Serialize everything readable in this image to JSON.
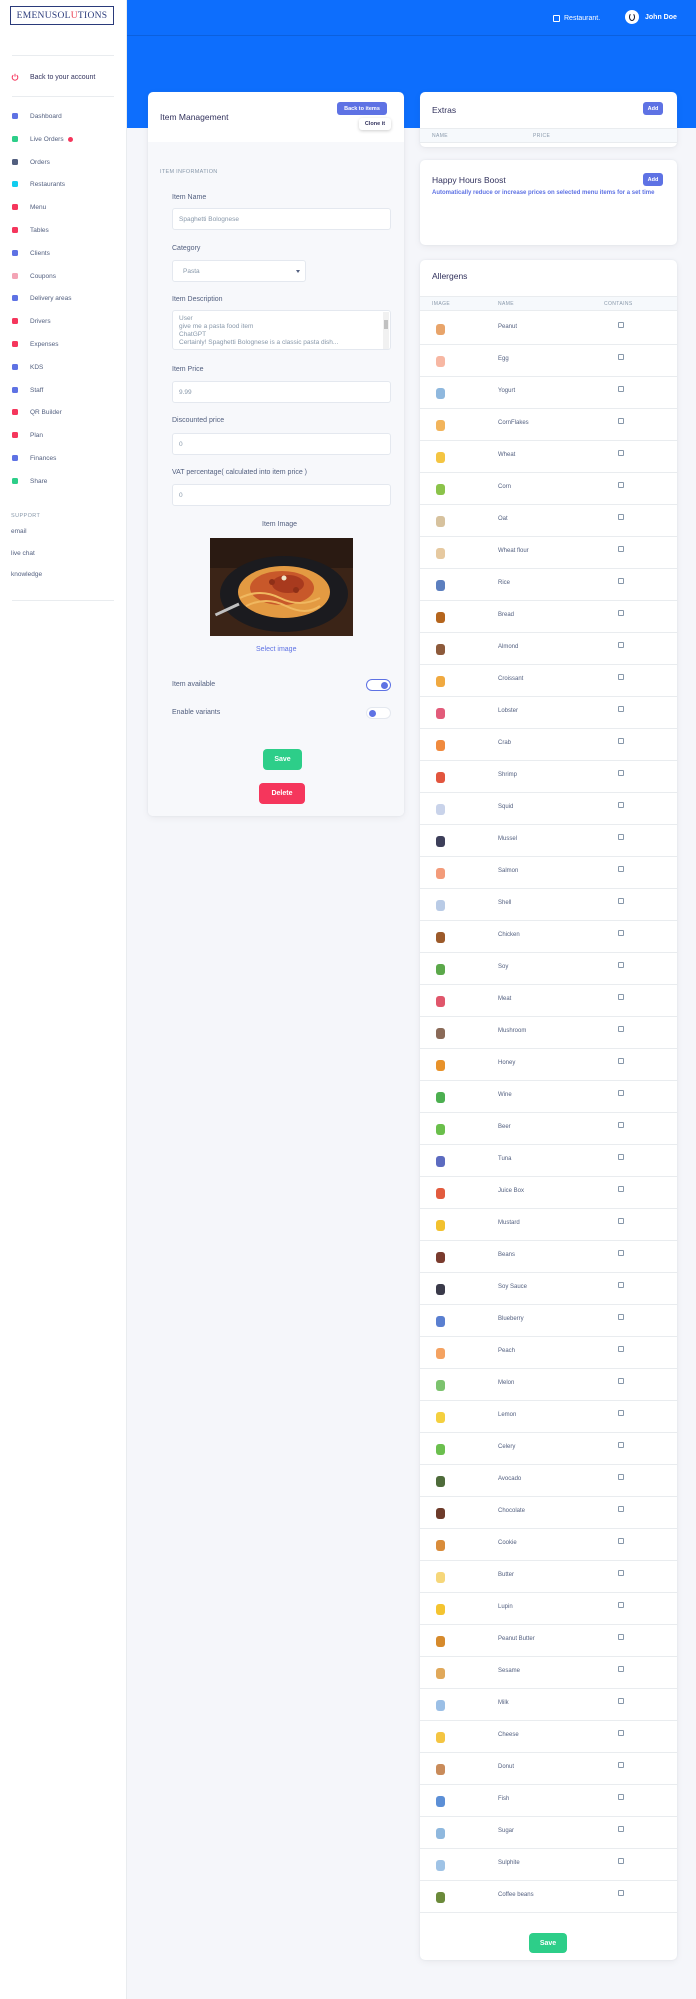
{
  "brand": {
    "logo_prefix": "EMENUSOL",
    "logo_highlight": "U",
    "logo_suffix": "TIONS"
  },
  "sidebar": {
    "back": "Back to your account",
    "items": [
      {
        "label": "Dashboard",
        "icon": "monitor-icon",
        "color": "#5e72e4"
      },
      {
        "label": "Live Orders",
        "icon": "grid-icon",
        "color": "#2dce89"
      },
      {
        "label": "Orders",
        "icon": "basket-icon",
        "color": "#525f7f"
      },
      {
        "label": "Restaurants",
        "icon": "shop-icon",
        "color": "#11cdef"
      },
      {
        "label": "Menu",
        "icon": "book-icon",
        "color": "#f5365c"
      },
      {
        "label": "Tables",
        "icon": "table-icon",
        "color": "#f5365c"
      },
      {
        "label": "Clients",
        "icon": "user-icon",
        "color": "#5e72e4"
      },
      {
        "label": "Coupons",
        "icon": "tag-icon",
        "color": "#f3a4b5"
      },
      {
        "label": "Delivery areas",
        "icon": "pin-icon",
        "color": "#5e72e4"
      },
      {
        "label": "Drivers",
        "icon": "driver-icon",
        "color": "#f5365c"
      },
      {
        "label": "Expenses",
        "icon": "bill-icon",
        "color": "#f5365c"
      },
      {
        "label": "KDS",
        "icon": "screen-icon",
        "color": "#5e72e4"
      },
      {
        "label": "Staff",
        "icon": "staff-icon",
        "color": "#5e72e4"
      },
      {
        "label": "QR Builder",
        "icon": "qr-icon",
        "color": "#f5365c"
      },
      {
        "label": "Plan",
        "icon": "card-icon",
        "color": "#f5365c"
      },
      {
        "label": "Finances",
        "icon": "finance-icon",
        "color": "#5e72e4"
      },
      {
        "label": "Share",
        "icon": "share-icon",
        "color": "#2dce89"
      }
    ],
    "support_heading": "SUPPORT",
    "support_links": [
      "email",
      "live chat",
      "knowledge"
    ]
  },
  "header": {
    "restaurant": "Restaurant.",
    "user": "John Doe"
  },
  "item_management": {
    "title": "Item Management",
    "back_button": "Back to items",
    "clone_button": "Clone it",
    "section": "ITEM INFORMATION",
    "name_label": "Item Name",
    "name_value": "Spaghetti Bolognese",
    "category_label": "Category",
    "category_value": "Pasta",
    "description_label": "Item Description",
    "description_lines": [
      "User",
      "give me a pasta food item",
      "ChatGPT",
      "Certainly! Spaghetti Bolognese is a classic pasta dish..."
    ],
    "price_label": "Item Price",
    "price_value": "9.99",
    "discount_label": "Discounted price",
    "discount_value": "0",
    "vat_label": "VAT percentage( calculated into item price )",
    "vat_value": "0",
    "image_label": "Item Image",
    "select_image": "Select image",
    "available_label": "Item available",
    "available_on": true,
    "variants_label": "Enable variants",
    "variants_on": false,
    "save": "Save",
    "delete": "Delete"
  },
  "extras": {
    "title": "Extras",
    "add": "Add",
    "col_name": "NAME",
    "col_price": "PRICE"
  },
  "happy_hours": {
    "title": "Happy Hours Boost",
    "add": "Add",
    "description": "Automatically reduce or increase prices on selected menu items for a set time"
  },
  "allergens": {
    "title": "Allergens",
    "col_image": "IMAGE",
    "col_name": "NAME",
    "col_contains": "CONTAINS",
    "save": "Save",
    "items": [
      {
        "name": "Peanut",
        "icon": "peanut-icon",
        "color": "#e8a46a"
      },
      {
        "name": "Egg",
        "icon": "egg-icon",
        "color": "#f7b7a3"
      },
      {
        "name": "Yogurt",
        "icon": "yogurt-icon",
        "color": "#8fb8de"
      },
      {
        "name": "CornFlakes",
        "icon": "cornflakes-icon",
        "color": "#f2b45b"
      },
      {
        "name": "Wheat",
        "icon": "wheat-icon",
        "color": "#f4c542"
      },
      {
        "name": "Corn",
        "icon": "corn-icon",
        "color": "#8bc34a"
      },
      {
        "name": "Oat",
        "icon": "oat-icon",
        "color": "#d7c29e"
      },
      {
        "name": "Wheat flour",
        "icon": "flour-icon",
        "color": "#e6c9a0"
      },
      {
        "name": "Rice",
        "icon": "rice-icon",
        "color": "#5c7fbf"
      },
      {
        "name": "Bread",
        "icon": "bread-icon",
        "color": "#b5651d"
      },
      {
        "name": "Almond",
        "icon": "almond-icon",
        "color": "#8d5a3b"
      },
      {
        "name": "Croissant",
        "icon": "croissant-icon",
        "color": "#f0a940"
      },
      {
        "name": "Lobster",
        "icon": "lobster-icon",
        "color": "#e25b7a"
      },
      {
        "name": "Crab",
        "icon": "crab-icon",
        "color": "#f08a3e"
      },
      {
        "name": "Shrimp",
        "icon": "shrimp-icon",
        "color": "#e2553e"
      },
      {
        "name": "Squid",
        "icon": "squid-icon",
        "color": "#c9d3ea"
      },
      {
        "name": "Mussel",
        "icon": "mussel-icon",
        "color": "#3d3f5a"
      },
      {
        "name": "Salmon",
        "icon": "salmon-icon",
        "color": "#f39b7a"
      },
      {
        "name": "Shell",
        "icon": "shell-icon",
        "color": "#b9cbe6"
      },
      {
        "name": "Chicken",
        "icon": "chicken-icon",
        "color": "#9c5a2a"
      },
      {
        "name": "Soy",
        "icon": "soy-icon",
        "color": "#5ba84a"
      },
      {
        "name": "Meat",
        "icon": "meat-icon",
        "color": "#e0566b"
      },
      {
        "name": "Mushroom",
        "icon": "mushroom-icon",
        "color": "#8a6a58"
      },
      {
        "name": "Honey",
        "icon": "honey-icon",
        "color": "#e8922a"
      },
      {
        "name": "Wine",
        "icon": "wine-icon",
        "color": "#4caf50"
      },
      {
        "name": "Beer",
        "icon": "beer-icon",
        "color": "#6abf4b"
      },
      {
        "name": "Tuna",
        "icon": "tuna-icon",
        "color": "#5c6bc0"
      },
      {
        "name": "Juice Box",
        "icon": "juicebox-icon",
        "color": "#e25b3e"
      },
      {
        "name": "Mustard",
        "icon": "mustard-icon",
        "color": "#f2c12e"
      },
      {
        "name": "Beans",
        "icon": "beans-icon",
        "color": "#7a3b2e"
      },
      {
        "name": "Soy Sauce",
        "icon": "soysauce-icon",
        "color": "#3a3a4a"
      },
      {
        "name": "Blueberry",
        "icon": "blueberry-icon",
        "color": "#5a7fd0"
      },
      {
        "name": "Peach",
        "icon": "peach-icon",
        "color": "#f4a261"
      },
      {
        "name": "Melon",
        "icon": "melon-icon",
        "color": "#7cc36e"
      },
      {
        "name": "Lemon",
        "icon": "lemon-icon",
        "color": "#f4d03f"
      },
      {
        "name": "Celery",
        "icon": "celery-icon",
        "color": "#6bbf4e"
      },
      {
        "name": "Avocado",
        "icon": "avocado-icon",
        "color": "#4e6b3a"
      },
      {
        "name": "Chocolate",
        "icon": "chocolate-icon",
        "color": "#6d3b2a"
      },
      {
        "name": "Cookie",
        "icon": "cookie-icon",
        "color": "#d98c3a"
      },
      {
        "name": "Butter",
        "icon": "butter-icon",
        "color": "#f6d77a"
      },
      {
        "name": "Lupin",
        "icon": "lupin-icon",
        "color": "#f4c430"
      },
      {
        "name": "Peanut Butter",
        "icon": "peanutbutter-icon",
        "color": "#d68a2c"
      },
      {
        "name": "Sesame",
        "icon": "sesame-icon",
        "color": "#e0a85a"
      },
      {
        "name": "Milk",
        "icon": "milk-icon",
        "color": "#9bbfe6"
      },
      {
        "name": "Cheese",
        "icon": "cheese-icon",
        "color": "#f4c542"
      },
      {
        "name": "Donut",
        "icon": "donut-icon",
        "color": "#c98b5a"
      },
      {
        "name": "Fish",
        "icon": "fish-icon",
        "color": "#5c8fd6"
      },
      {
        "name": "Sugar",
        "icon": "sugar-icon",
        "color": "#8fb8de"
      },
      {
        "name": "Sulphite",
        "icon": "sulphite-icon",
        "color": "#9fc3e6"
      },
      {
        "name": "Coffee beans",
        "icon": "coffeebeans-icon",
        "color": "#6b8a3a"
      }
    ]
  }
}
